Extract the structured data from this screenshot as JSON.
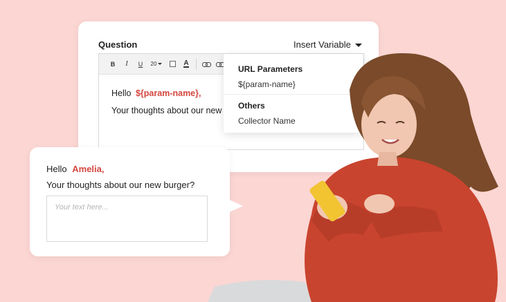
{
  "editor": {
    "question_label": "Question",
    "insert_variable_label": "Insert Variable",
    "toolbar": {
      "bold": "B",
      "italic": "I",
      "underline": "U",
      "font_size": "20",
      "font_color": "A"
    },
    "greeting": "Hello",
    "param_token": "${param-name},",
    "question_text": "Your thoughts about our new"
  },
  "dropdown": {
    "sections": [
      {
        "heading": "URL Parameters",
        "items": [
          "${param-name}"
        ]
      },
      {
        "heading": "Others",
        "items": [
          "Collector Name"
        ]
      }
    ]
  },
  "preview": {
    "greeting": "Hello",
    "name": "Amelia,",
    "question_text": "Your thoughts about our new burger?",
    "input_placeholder": "Your text here..."
  },
  "colors": {
    "background": "#fbd6d3",
    "accent": "#d4463f",
    "sweater": "#c9442e"
  }
}
